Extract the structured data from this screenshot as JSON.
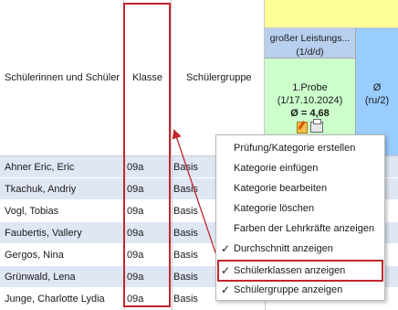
{
  "header": {
    "col_name": "Schülerinnen und Schüler",
    "col_class": "Klasse",
    "col_group": "Schülergruppe",
    "category_title": "großer Leistungs...",
    "category_sub": "(1/d/d)",
    "exam_name": "1.Probe",
    "exam_date": "(1/17.10.2024)",
    "exam_avg": "Ø = 4,68",
    "avg_symbol": "Ø",
    "avg_sub": "(ru/2)"
  },
  "rows": [
    {
      "name": "Ahner Eric, Eric",
      "klasse": "09a",
      "gruppe": "Basis"
    },
    {
      "name": "Tkachuk, Andriy",
      "klasse": "09a",
      "gruppe": "Basis"
    },
    {
      "name": "Vogl, Tobias",
      "klasse": "09a",
      "gruppe": "Basis"
    },
    {
      "name": "Faubertis, Vallery",
      "klasse": "09a",
      "gruppe": "Basis"
    },
    {
      "name": "Gergos, Nina",
      "klasse": "09a",
      "gruppe": "Basis"
    },
    {
      "name": "Grünwald, Lena",
      "klasse": "09a",
      "gruppe": "Basis"
    },
    {
      "name": "Junge, Charlotte Lydia",
      "klasse": "09a",
      "gruppe": "Basis"
    }
  ],
  "context_menu": {
    "items": [
      {
        "label": "Prüfung/Kategorie erstellen",
        "checked": false
      },
      {
        "label": "Kategorie einfügen",
        "checked": false
      },
      {
        "label": "Kategorie bearbeiten",
        "checked": false
      },
      {
        "label": "Kategorie löschen",
        "checked": false
      },
      {
        "label": "Farben der Lehrkräfte anzeigen",
        "checked": false
      },
      {
        "label": "Durchschnitt anzeigen",
        "checked": true
      },
      {
        "label": "Schülerklassen anzeigen",
        "checked": true
      },
      {
        "label": "Schülergruppe anzeigen",
        "checked": true
      }
    ],
    "check_glyph": "✓"
  },
  "colors": {
    "row_alt": "#dfe6f4",
    "highlight": "#c0272d",
    "category_header": "#b8cfee",
    "exam_cell": "#ccffcc",
    "avg_cell": "#99ccff",
    "top_band": "#ffff99"
  },
  "icons": [
    "edit-icon",
    "print-icon",
    "check-icon"
  ]
}
